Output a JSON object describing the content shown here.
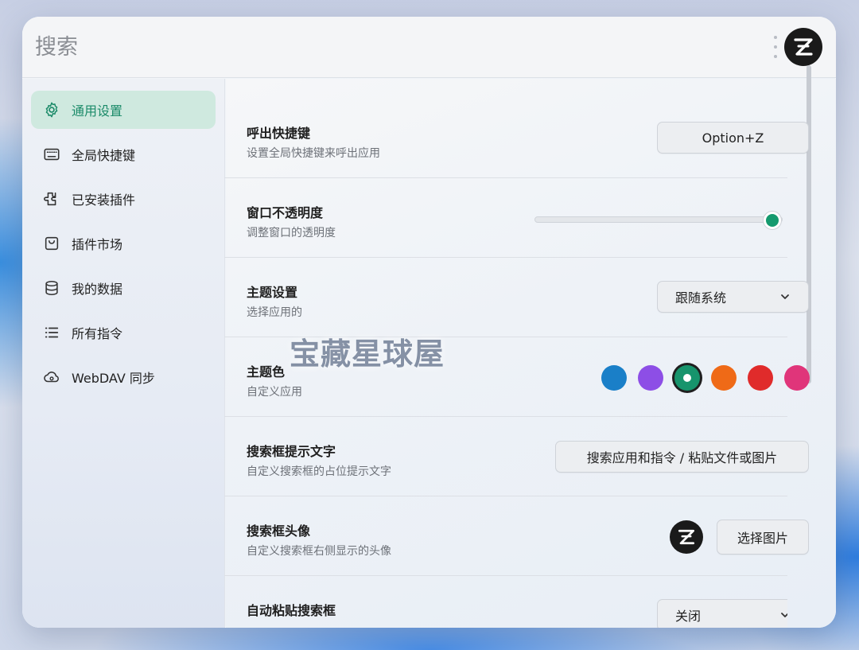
{
  "header": {
    "search_placeholder": "搜索",
    "avatar_letter": "Z"
  },
  "sidebar": {
    "items": [
      {
        "label": "通用设置"
      },
      {
        "label": "全局快捷键"
      },
      {
        "label": "已安装插件"
      },
      {
        "label": "插件市场"
      },
      {
        "label": "我的数据"
      },
      {
        "label": "所有指令"
      },
      {
        "label": "WebDAV 同步"
      }
    ]
  },
  "settings": {
    "hotkey": {
      "title": "呼出快捷键",
      "desc": "设置全局快捷键来呼出应用",
      "value": "Option+Z"
    },
    "opacity": {
      "title": "窗口不透明度",
      "desc": "调整窗口的透明度",
      "value": 1.0
    },
    "theme": {
      "title": "主题设置",
      "desc": "选择应用的",
      "value": "跟随系统"
    },
    "theme_color": {
      "title": "主题色",
      "desc": "自定义应用",
      "colors": [
        "#1a7fc8",
        "#8d4ee6",
        "#17946c",
        "#ef6a17",
        "#e02b2b",
        "#e0357a"
      ],
      "selected_index": 2
    },
    "placeholder": {
      "title": "搜索框提示文字",
      "desc": "自定义搜索框的占位提示文字",
      "value": "搜索应用和指令 / 粘贴文件或图片"
    },
    "avatar": {
      "title": "搜索框头像",
      "desc": "自定义搜索框右侧显示的头像",
      "button_label": "选择图片"
    },
    "auto_paste": {
      "title": "自动粘贴搜索框",
      "value": "关闭"
    }
  },
  "watermark": "宝藏星球屋"
}
